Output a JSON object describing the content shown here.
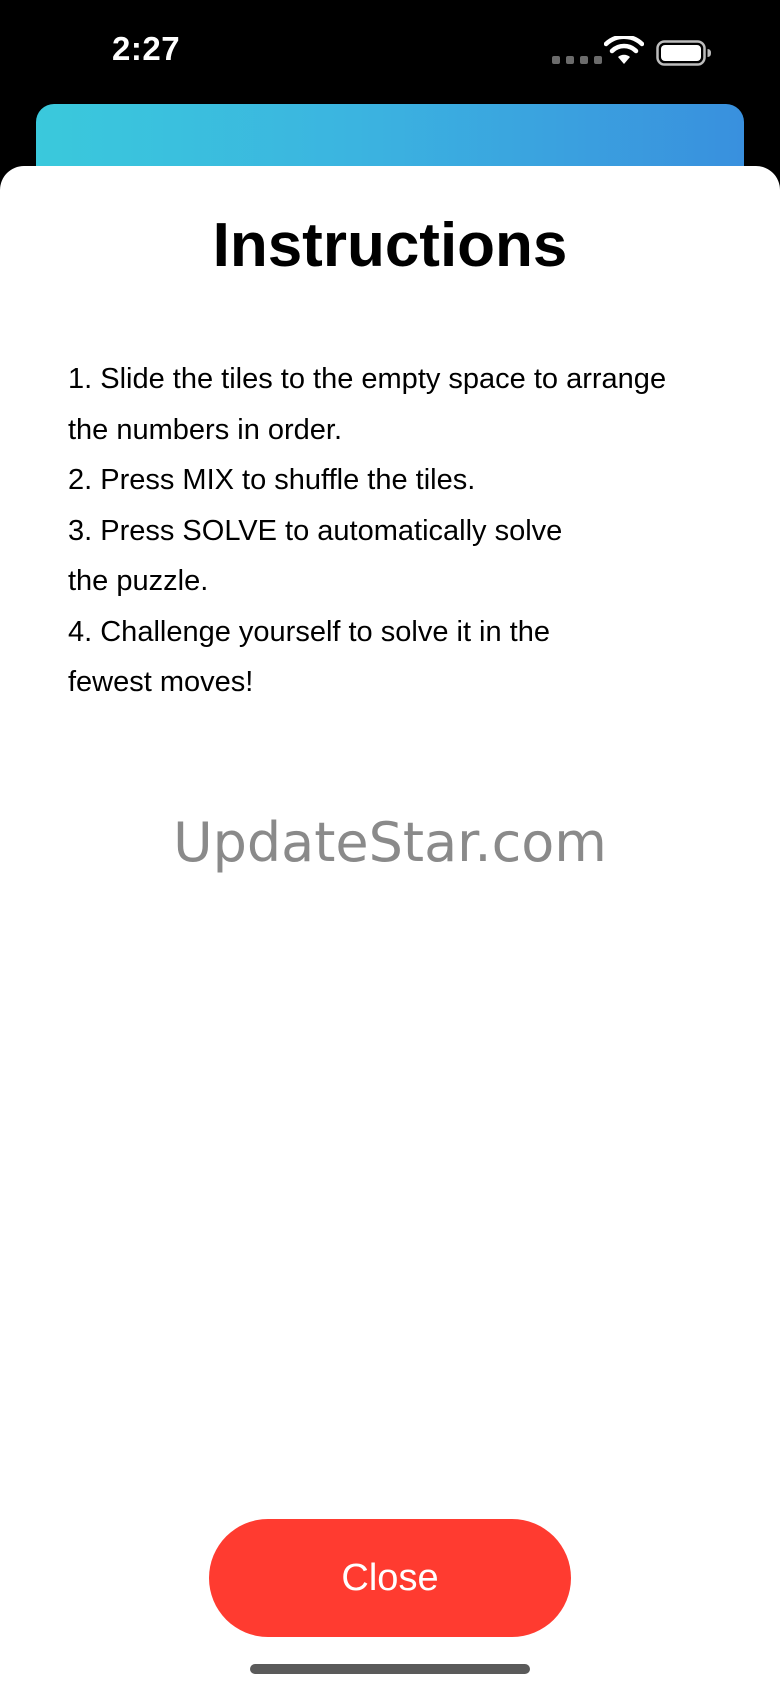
{
  "status_bar": {
    "time": "2:27"
  },
  "sheet": {
    "title": "Instructions",
    "instructions": [
      "1. Slide the tiles to the empty space to arrange the numbers in order.",
      "2. Press MIX to shuffle the tiles.",
      "3. Press SOLVE to automatically solve the puzzle.",
      "4. Challenge yourself to solve it in the fewest moves!"
    ],
    "instructions_display": "1. Slide the tiles to the empty space to arrange\nthe numbers in order.\n2. Press MIX to shuffle the tiles.\n3. Press SOLVE to automatically solve\nthe puzzle.\n4. Challenge yourself to solve it in the\nfewest moves!",
    "watermark": "UpdateStar.com",
    "close_label": "Close"
  },
  "colors": {
    "accent_button": "#ff3b30",
    "header_gradient_start": "#3ac9dc",
    "header_gradient_end": "#3990de",
    "watermark": "#8a8a8a"
  },
  "icons": {
    "wifi": "wifi-icon",
    "battery": "battery-icon",
    "signal": "signal-dots-icon"
  }
}
